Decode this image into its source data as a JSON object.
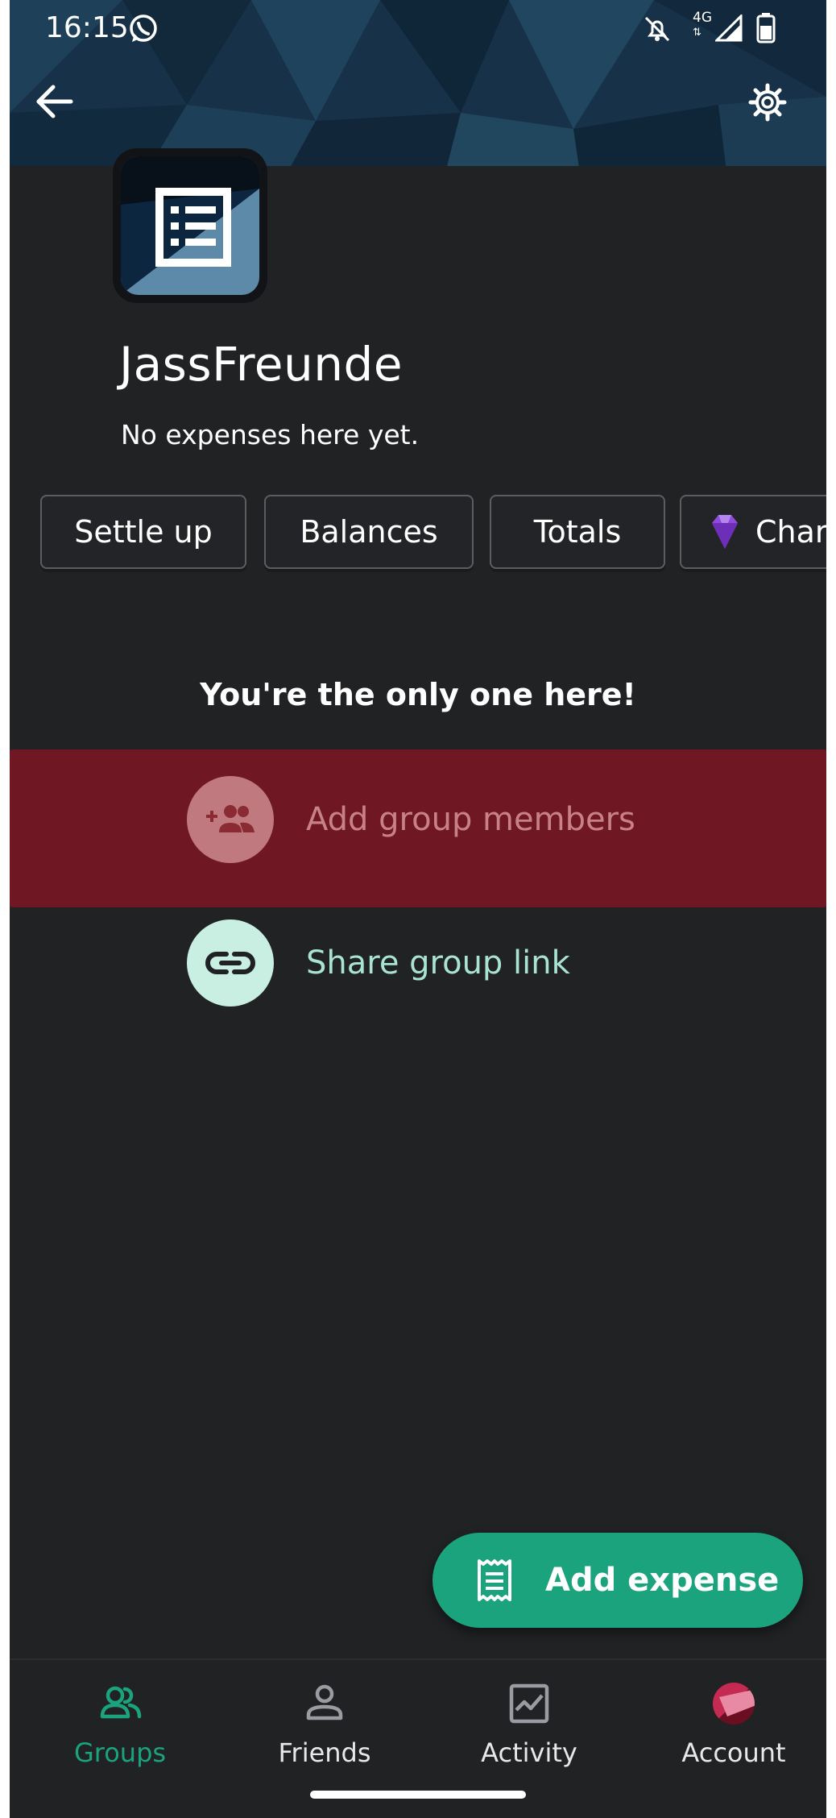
{
  "status_bar": {
    "time": "16:15",
    "network_label": "4G",
    "icons": [
      "whatsapp-icon",
      "bell-off-icon",
      "network-4g-icon",
      "signal-icon",
      "battery-icon"
    ]
  },
  "header": {
    "back_icon": "arrow-back-icon",
    "settings_icon": "gear-icon",
    "banner_colors": [
      "#1b3a52",
      "#0e2438",
      "#274c68"
    ]
  },
  "group": {
    "name": "JassFreunde",
    "subtitle": "No expenses here yet."
  },
  "chips": [
    {
      "label": "Settle up"
    },
    {
      "label": "Balances"
    },
    {
      "label": "Totals"
    },
    {
      "label": "Char",
      "icon": "diamond-icon"
    }
  ],
  "empty_state": {
    "title": "You're the only one here!",
    "add_members_label": "Add group members",
    "share_link_label": "Share group link"
  },
  "fab": {
    "label": "Add expense",
    "icon": "receipt-icon"
  },
  "bottom_nav": {
    "items": [
      {
        "label": "Groups",
        "icon": "groups-icon",
        "active": true
      },
      {
        "label": "Friends",
        "icon": "person-icon",
        "active": false
      },
      {
        "label": "Activity",
        "icon": "activity-icon",
        "active": false
      },
      {
        "label": "Account",
        "icon": "avatar-icon",
        "active": false
      }
    ]
  },
  "colors": {
    "accent": "#1ba37e",
    "active_nav": "#1ba37e",
    "share_link": "#a9e3d2",
    "highlight": "#a01224"
  }
}
